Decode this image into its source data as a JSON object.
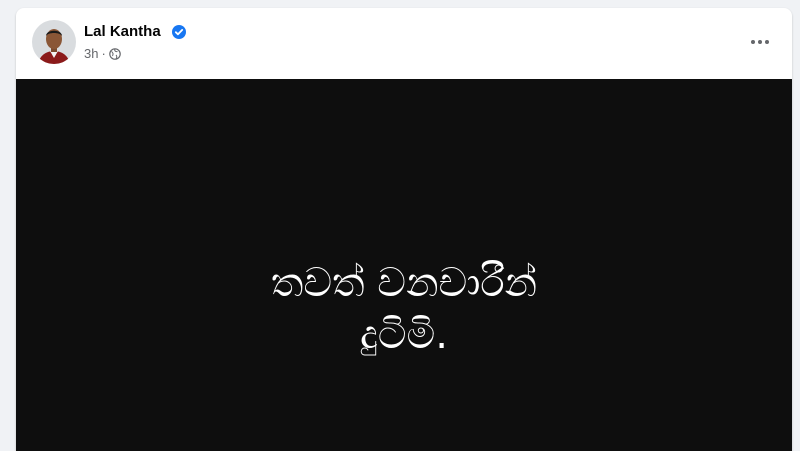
{
  "post": {
    "author": "Lal Kantha",
    "verified": true,
    "time": "3h",
    "time_separator": "·",
    "privacy_icon": "globe-icon",
    "more_icon": "more-options-icon",
    "image_text_lines": [
      "තවත් වනචාරීන්",
      "දුටිමි."
    ]
  },
  "colors": {
    "page_background": "#f0f2f5",
    "verified_badge": "#1877f2",
    "image_background": "#0e0e0e"
  }
}
